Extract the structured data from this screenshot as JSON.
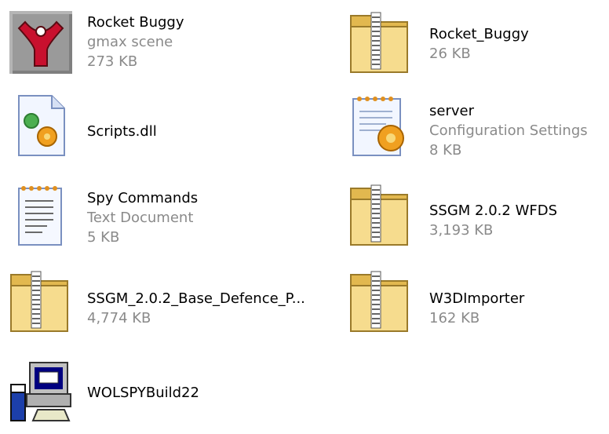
{
  "colors": {
    "name_text": "#000000",
    "detail_text": "#8a8a8a",
    "folder": "#f3d27a",
    "zipper": "#6e6e6e"
  },
  "files": [
    {
      "name": "Rocket Buggy",
      "type": "gmax scene",
      "size": "273 KB",
      "icon": "gmax-scene-icon"
    },
    {
      "name": "Rocket_Buggy",
      "size": "26 KB",
      "icon": "compressed-folder-icon"
    },
    {
      "name": "Scripts.dll",
      "icon": "dll-file-icon"
    },
    {
      "name": "server",
      "type": "Configuration Settings",
      "size": "8 KB",
      "icon": "config-settings-icon"
    },
    {
      "name": "Spy Commands",
      "type": "Text Document",
      "size": "5 KB",
      "icon": "text-document-icon"
    },
    {
      "name": "SSGM 2.0.2 WFDS",
      "size": "3,193 KB",
      "icon": "compressed-folder-icon"
    },
    {
      "name": "SSGM_2.0.2_Base_Defence_P...",
      "size": "4,774 KB",
      "icon": "compressed-folder-icon"
    },
    {
      "name": "W3DImporter",
      "size": "162 KB",
      "icon": "compressed-folder-icon"
    },
    {
      "name": "WOLSPYBuild22",
      "icon": "setup-program-icon"
    }
  ]
}
